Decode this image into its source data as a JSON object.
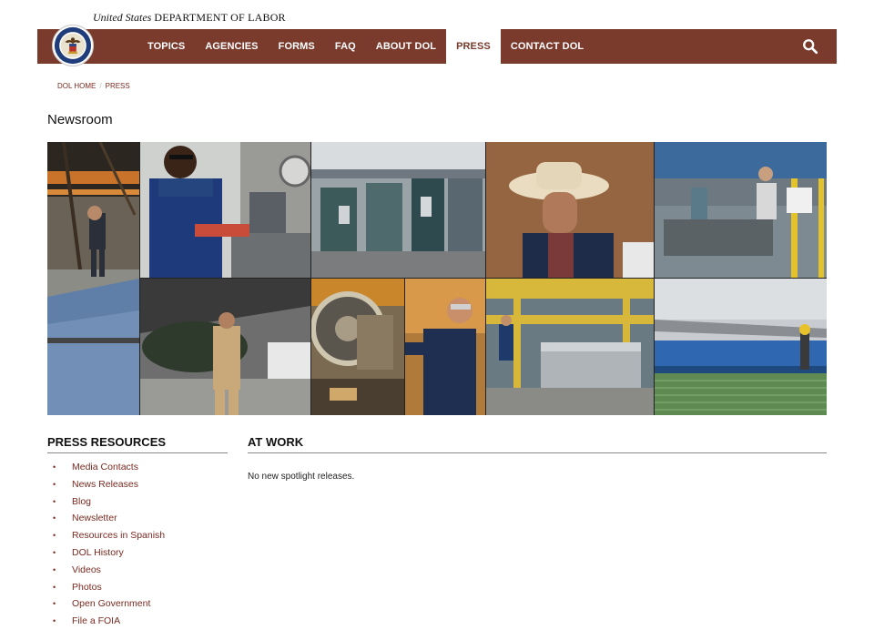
{
  "header": {
    "agency_prefix": "United States",
    "agency_dept": "DEPARTMENT OF LABOR",
    "seal": "dol-seal-icon"
  },
  "nav": {
    "items": [
      {
        "label": "TOPICS",
        "active": false
      },
      {
        "label": "AGENCIES",
        "active": false
      },
      {
        "label": "FORMS",
        "active": false
      },
      {
        "label": "FAQ",
        "active": false
      },
      {
        "label": "ABOUT DOL",
        "active": false
      },
      {
        "label": "PRESS",
        "active": true
      },
      {
        "label": "CONTACT DOL",
        "active": false
      }
    ],
    "search_icon": "search-icon"
  },
  "breadcrumb": {
    "home": "DOL HOME",
    "separator": "/",
    "current": "PRESS"
  },
  "page_title": "Newsroom",
  "sidebar": {
    "heading": "PRESS RESOURCES",
    "items": [
      {
        "label": "Media Contacts"
      },
      {
        "label": "News Releases"
      },
      {
        "label": "Blog"
      },
      {
        "label": "Newsletter"
      },
      {
        "label": "Resources in Spanish"
      },
      {
        "label": "DOL History"
      },
      {
        "label": "Videos"
      },
      {
        "label": "Photos"
      },
      {
        "label": "Open Government"
      },
      {
        "label": "File a FOIA"
      }
    ]
  },
  "at_work": {
    "heading": "AT WORK",
    "empty_text": "No new spotlight releases."
  },
  "colors": {
    "brand": "#7a3a2c",
    "link": "#7a2a20"
  }
}
